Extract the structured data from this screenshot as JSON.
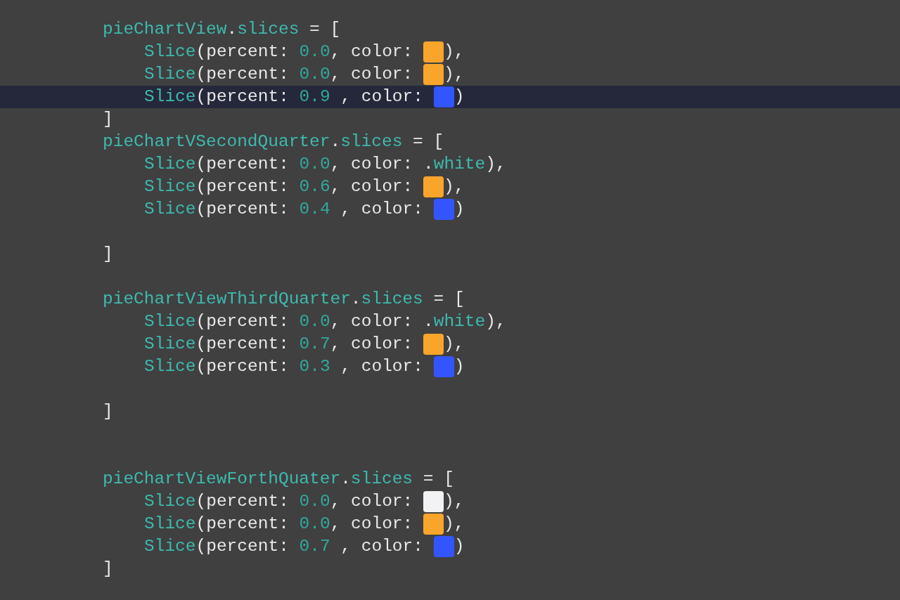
{
  "editor": {
    "lines": [
      {
        "kind": "statement",
        "highlighted": false,
        "tokens": [
          {
            "kind": "ident",
            "text": "pieChartView"
          },
          {
            "kind": "plain",
            "text": "."
          },
          {
            "kind": "ident",
            "text": "slices"
          },
          {
            "kind": "plain",
            "text": " = ["
          }
        ]
      },
      {
        "kind": "element",
        "highlighted": false,
        "tokens": [
          {
            "kind": "ident",
            "text": "Slice"
          },
          {
            "kind": "plain",
            "text": "(percent: "
          },
          {
            "kind": "number",
            "text": "0.0"
          },
          {
            "kind": "plain",
            "text": ", color: "
          },
          {
            "kind": "swatch",
            "color": "#f9a42a"
          },
          {
            "kind": "plain",
            "text": "),"
          }
        ]
      },
      {
        "kind": "element",
        "highlighted": false,
        "tokens": [
          {
            "kind": "ident",
            "text": "Slice"
          },
          {
            "kind": "plain",
            "text": "(percent: "
          },
          {
            "kind": "number",
            "text": "0.0"
          },
          {
            "kind": "plain",
            "text": ", color: "
          },
          {
            "kind": "swatch",
            "color": "#f9a42a"
          },
          {
            "kind": "plain",
            "text": "),"
          }
        ]
      },
      {
        "kind": "element",
        "highlighted": true,
        "tokens": [
          {
            "kind": "ident",
            "text": "Slice"
          },
          {
            "kind": "plain",
            "text": "(percent: "
          },
          {
            "kind": "number",
            "text": "0.9"
          },
          {
            "kind": "plain",
            "text": " , color: "
          },
          {
            "kind": "swatch",
            "color": "#3355ff"
          },
          {
            "kind": "plain",
            "text": ")"
          }
        ]
      },
      {
        "kind": "close",
        "highlighted": false,
        "tokens": [
          {
            "kind": "plain",
            "text": "]"
          }
        ]
      },
      {
        "kind": "statement",
        "highlighted": false,
        "tokens": [
          {
            "kind": "ident",
            "text": "pieChartVSecondQuarter"
          },
          {
            "kind": "plain",
            "text": "."
          },
          {
            "kind": "ident",
            "text": "slices"
          },
          {
            "kind": "plain",
            "text": " = ["
          }
        ]
      },
      {
        "kind": "element",
        "highlighted": false,
        "tokens": [
          {
            "kind": "ident",
            "text": "Slice"
          },
          {
            "kind": "plain",
            "text": "(percent: "
          },
          {
            "kind": "number",
            "text": "0.0"
          },
          {
            "kind": "plain",
            "text": ", color: ."
          },
          {
            "kind": "ident",
            "text": "white"
          },
          {
            "kind": "plain",
            "text": "),"
          }
        ]
      },
      {
        "kind": "element",
        "highlighted": false,
        "tokens": [
          {
            "kind": "ident",
            "text": "Slice"
          },
          {
            "kind": "plain",
            "text": "(percent: "
          },
          {
            "kind": "number",
            "text": "0.6"
          },
          {
            "kind": "plain",
            "text": ", color: "
          },
          {
            "kind": "swatch",
            "color": "#f9a42a"
          },
          {
            "kind": "plain",
            "text": "),"
          }
        ]
      },
      {
        "kind": "element",
        "highlighted": false,
        "tokens": [
          {
            "kind": "ident",
            "text": "Slice"
          },
          {
            "kind": "plain",
            "text": "(percent: "
          },
          {
            "kind": "number",
            "text": "0.4"
          },
          {
            "kind": "plain",
            "text": " , color: "
          },
          {
            "kind": "swatch",
            "color": "#3355ff"
          },
          {
            "kind": "plain",
            "text": ")"
          }
        ]
      },
      {
        "kind": "blank",
        "highlighted": false
      },
      {
        "kind": "close",
        "highlighted": false,
        "tokens": [
          {
            "kind": "plain",
            "text": "]"
          }
        ]
      },
      {
        "kind": "blank",
        "highlighted": false
      },
      {
        "kind": "statement",
        "highlighted": false,
        "tokens": [
          {
            "kind": "ident",
            "text": "pieChartViewThirdQuarter"
          },
          {
            "kind": "plain",
            "text": "."
          },
          {
            "kind": "ident",
            "text": "slices"
          },
          {
            "kind": "plain",
            "text": " = ["
          }
        ]
      },
      {
        "kind": "element",
        "highlighted": false,
        "tokens": [
          {
            "kind": "ident",
            "text": "Slice"
          },
          {
            "kind": "plain",
            "text": "(percent: "
          },
          {
            "kind": "number",
            "text": "0.0"
          },
          {
            "kind": "plain",
            "text": ", color: ."
          },
          {
            "kind": "ident",
            "text": "white"
          },
          {
            "kind": "plain",
            "text": "),"
          }
        ]
      },
      {
        "kind": "element",
        "highlighted": false,
        "tokens": [
          {
            "kind": "ident",
            "text": "Slice"
          },
          {
            "kind": "plain",
            "text": "(percent: "
          },
          {
            "kind": "number",
            "text": "0.7"
          },
          {
            "kind": "plain",
            "text": ", color: "
          },
          {
            "kind": "swatch",
            "color": "#f9a42a"
          },
          {
            "kind": "plain",
            "text": "),"
          }
        ]
      },
      {
        "kind": "element",
        "highlighted": false,
        "tokens": [
          {
            "kind": "ident",
            "text": "Slice"
          },
          {
            "kind": "plain",
            "text": "(percent: "
          },
          {
            "kind": "number",
            "text": "0.3"
          },
          {
            "kind": "plain",
            "text": " , color: "
          },
          {
            "kind": "swatch",
            "color": "#3355ff"
          },
          {
            "kind": "plain",
            "text": ")"
          }
        ]
      },
      {
        "kind": "blank",
        "highlighted": false
      },
      {
        "kind": "close",
        "highlighted": false,
        "tokens": [
          {
            "kind": "plain",
            "text": "]"
          }
        ]
      },
      {
        "kind": "blank",
        "highlighted": false
      },
      {
        "kind": "blank",
        "highlighted": false
      },
      {
        "kind": "statement",
        "highlighted": false,
        "tokens": [
          {
            "kind": "ident",
            "text": "pieChartViewForthQuater"
          },
          {
            "kind": "plain",
            "text": "."
          },
          {
            "kind": "ident",
            "text": "slices"
          },
          {
            "kind": "plain",
            "text": " = ["
          }
        ]
      },
      {
        "kind": "element",
        "highlighted": false,
        "tokens": [
          {
            "kind": "ident",
            "text": "Slice"
          },
          {
            "kind": "plain",
            "text": "(percent: "
          },
          {
            "kind": "number",
            "text": "0.0"
          },
          {
            "kind": "plain",
            "text": ", color: "
          },
          {
            "kind": "swatch",
            "color": "#f2f2f4"
          },
          {
            "kind": "plain",
            "text": "),"
          }
        ]
      },
      {
        "kind": "element",
        "highlighted": false,
        "tokens": [
          {
            "kind": "ident",
            "text": "Slice"
          },
          {
            "kind": "plain",
            "text": "(percent: "
          },
          {
            "kind": "number",
            "text": "0.0"
          },
          {
            "kind": "plain",
            "text": ", color: "
          },
          {
            "kind": "swatch",
            "color": "#f9a42a"
          },
          {
            "kind": "plain",
            "text": "),"
          }
        ]
      },
      {
        "kind": "element",
        "highlighted": false,
        "tokens": [
          {
            "kind": "ident",
            "text": "Slice"
          },
          {
            "kind": "plain",
            "text": "(percent: "
          },
          {
            "kind": "number",
            "text": "0.7"
          },
          {
            "kind": "plain",
            "text": " , color: "
          },
          {
            "kind": "swatch",
            "color": "#3355ff"
          },
          {
            "kind": "plain",
            "text": ")"
          }
        ]
      },
      {
        "kind": "close",
        "highlighted": false,
        "tokens": [
          {
            "kind": "plain",
            "text": "]"
          }
        ]
      }
    ]
  }
}
